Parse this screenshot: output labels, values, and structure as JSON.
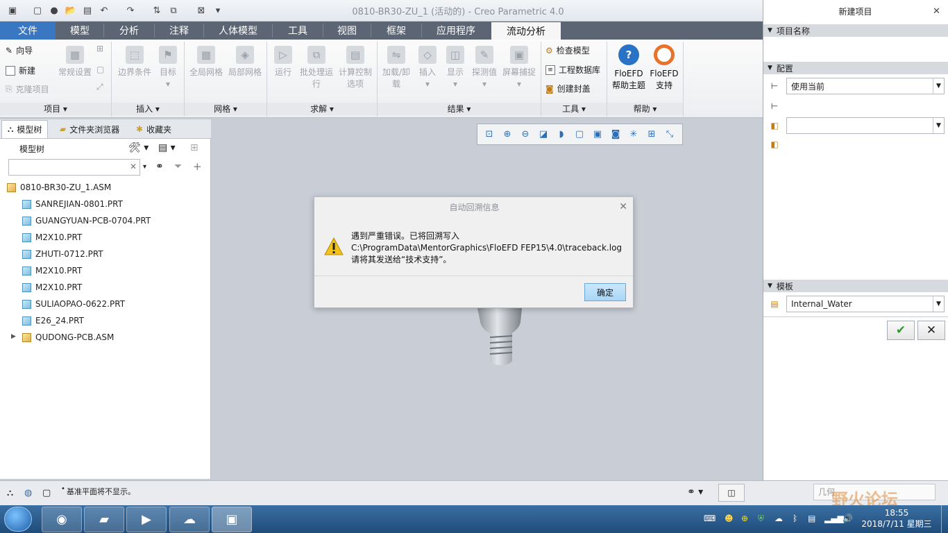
{
  "window": {
    "title": "0810-BR30-ZU_1 (活动的) - Creo Parametric 4.0"
  },
  "ribbon_tabs": [
    "文件",
    "模型",
    "分析",
    "注释",
    "人体模型",
    "工具",
    "视图",
    "框架",
    "应用程序",
    "流动分析"
  ],
  "ribbon": {
    "project": {
      "wizard": "向导",
      "new": "新建",
      "clone": "克隆项目",
      "general": "常规设置",
      "label": "项目 ▾"
    },
    "insert": {
      "boundary": "边界条件",
      "goal": "目标",
      "label": "插入 ▾"
    },
    "mesh": {
      "global": "全局网格",
      "local": "局部网格",
      "label": "网格 ▾"
    },
    "solve": {
      "run": "运行",
      "batch": "批处理运行",
      "calc": "计算控制选项",
      "label": "求解 ▾"
    },
    "results": {
      "load": "加载/卸载",
      "insert": "插入",
      "show": "显示",
      "probe": "探测值",
      "capture": "屏幕捕捉",
      "label": "结果 ▾"
    },
    "tools": {
      "check": "检查模型",
      "db": "工程数据库",
      "lids": "创建封盖",
      "label": "工具 ▾"
    },
    "help": {
      "topics": "FloEFD 帮助主题",
      "support": "FloEFD 支持",
      "label": "帮助 ▾"
    }
  },
  "left_tabs": [
    "模型树",
    "文件夹浏览器",
    "收藏夹"
  ],
  "tree": {
    "heading": "模型树",
    "items": [
      "0810-BR30-ZU_1.ASM",
      "SANREJIAN-0801.PRT",
      "GUANGYUAN-PCB-0704.PRT",
      "M2X10.PRT",
      "ZHUTI-0712.PRT",
      "M2X10.PRT",
      "M2X10.PRT",
      "SULIAOPAO-0622.PRT",
      "E26_24.PRT",
      "QUDONG-PCB.ASM"
    ]
  },
  "dialog": {
    "title": "自动回溯信息",
    "line1": "遇到严重错误。已将回溯写入",
    "line2": "C:\\ProgramData\\MentorGraphics\\FloEFD FEP15\\4.0\\traceback.log",
    "line3": "请将其发送给“技术支持”。",
    "ok": "确定"
  },
  "right_panel": {
    "title": "新建项目",
    "section_name": "项目名称",
    "section_config": "配置",
    "config_value": "使用当前",
    "section_template": "模板",
    "template_value": "Internal_Water"
  },
  "status": {
    "message": "基准平面将不显示。",
    "filter": "几何"
  },
  "clock": {
    "time": "18:55",
    "date": "2018/7/11 星期三"
  },
  "watermark": "野火论坛"
}
